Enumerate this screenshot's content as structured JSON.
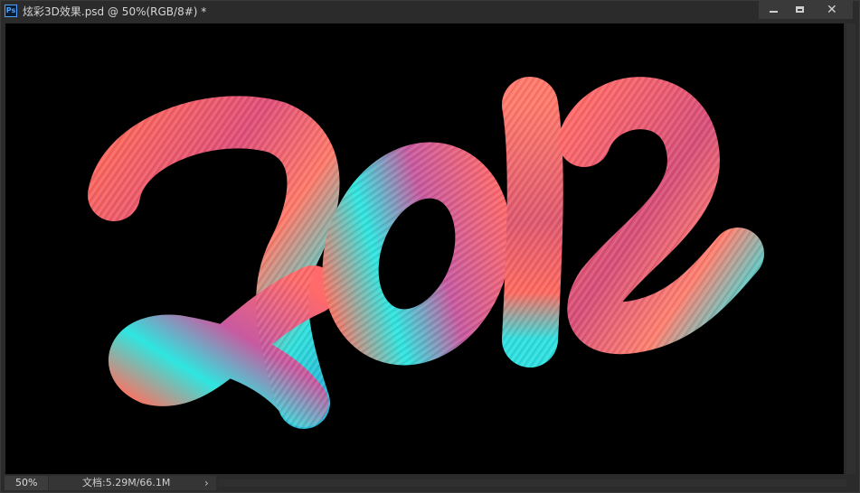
{
  "window": {
    "app_icon": "Ps",
    "title": "炫彩3D效果.psd @ 50%(RGB/8#) *",
    "buttons": {
      "minimize": "minimize-icon",
      "maximize": "maximize-icon",
      "close": "close-icon"
    }
  },
  "canvas": {
    "artwork_subject": "colorful 3D brush-stroke lettering",
    "background_color": "#000000",
    "stroke_colors": [
      "#ff5a5a",
      "#2ee6e6",
      "#b05ac8",
      "#ff8a80"
    ]
  },
  "status": {
    "zoom": "50%",
    "doc_info": "文档:5.29M/66.1M",
    "arrow": "›"
  }
}
